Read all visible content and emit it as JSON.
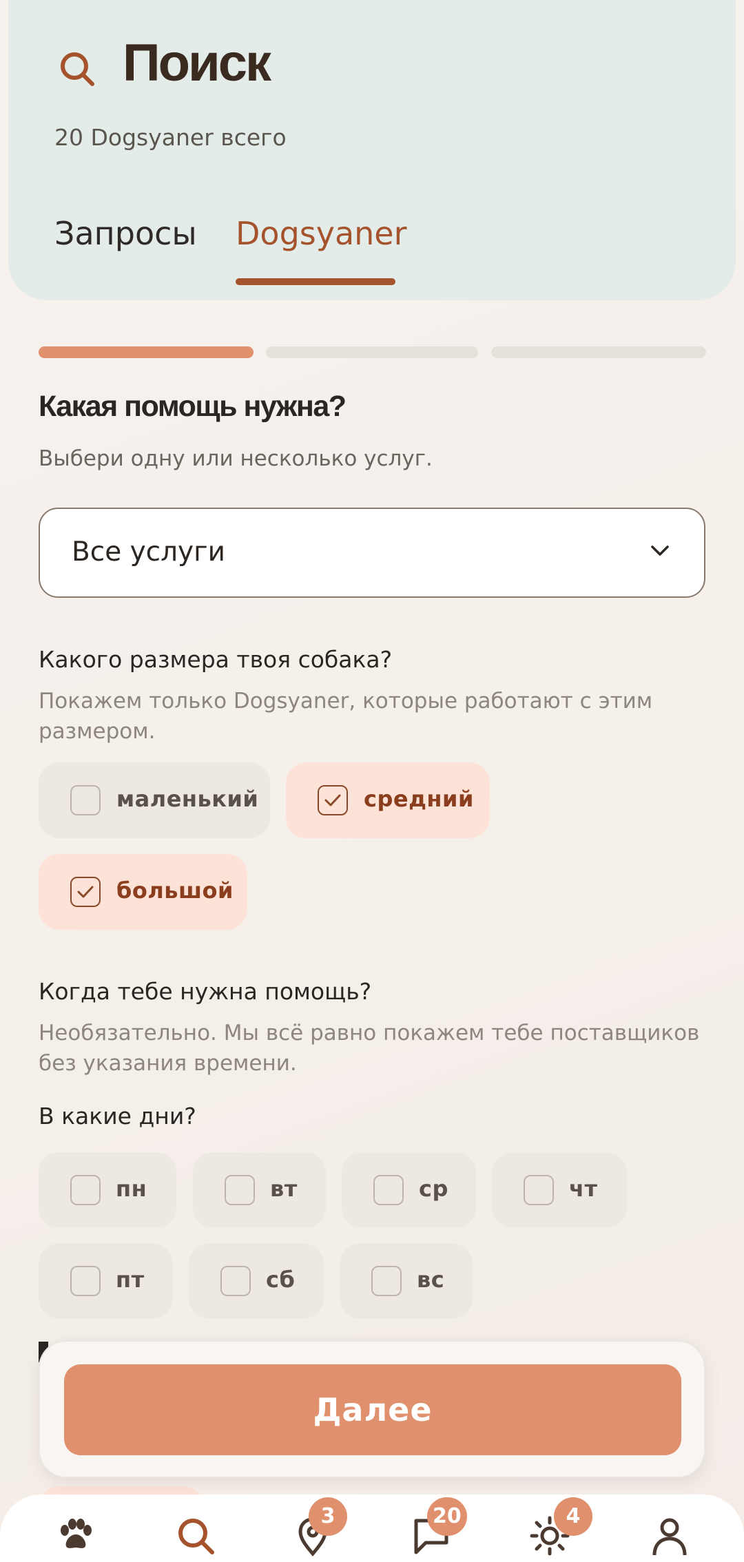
{
  "header": {
    "title": "Поиск",
    "subtitle": "20 Dogsyaner всего",
    "tabs": [
      {
        "label": "Запросы",
        "active": false
      },
      {
        "label": "Dogsyaner",
        "active": true
      }
    ]
  },
  "progress": {
    "current_step": 1,
    "total_steps": 3
  },
  "step": {
    "heading": "Какая помощь нужна?",
    "description": "Выбери одну или несколько услуг.",
    "service_select": {
      "value": "Все услуги"
    }
  },
  "dog_size": {
    "question": "Какого размера твоя собака?",
    "hint": "Покажем только Dogsyaner, которые работают с этим размером.",
    "options": [
      {
        "label": "маленький",
        "checked": false
      },
      {
        "label": "средний",
        "checked": true
      },
      {
        "label": "большой",
        "checked": true
      }
    ]
  },
  "when": {
    "question": "Когда тебе нужна помощь?",
    "hint": "Необязательно. Мы всё равно покажем тебе поставщиков без указания времени.",
    "days_question": "В какие дни?",
    "days": [
      {
        "label": "пн",
        "checked": false
      },
      {
        "label": "вт",
        "checked": false
      },
      {
        "label": "ср",
        "checked": false
      },
      {
        "label": "чт",
        "checked": false
      },
      {
        "label": "пт",
        "checked": false
      },
      {
        "label": "сб",
        "checked": false
      },
      {
        "label": "вс",
        "checked": false
      }
    ]
  },
  "footer": {
    "next_label": "Далее"
  },
  "nav": {
    "items": [
      {
        "icon": "paw-icon",
        "badge": null,
        "active": false
      },
      {
        "icon": "search-icon",
        "badge": null,
        "active": true
      },
      {
        "icon": "location-pin-icon",
        "badge": "3",
        "active": false
      },
      {
        "icon": "chat-icon",
        "badge": "20",
        "active": false
      },
      {
        "icon": "sun-icon",
        "badge": "4",
        "active": false
      },
      {
        "icon": "profile-icon",
        "badge": null,
        "active": false
      }
    ]
  },
  "colors": {
    "accent": "#e0906c",
    "accent_dark": "#a5532c",
    "header_bg": "#e3ece8",
    "chip_selected_bg": "#fde3d7",
    "chip_bg": "#ede8e2"
  }
}
